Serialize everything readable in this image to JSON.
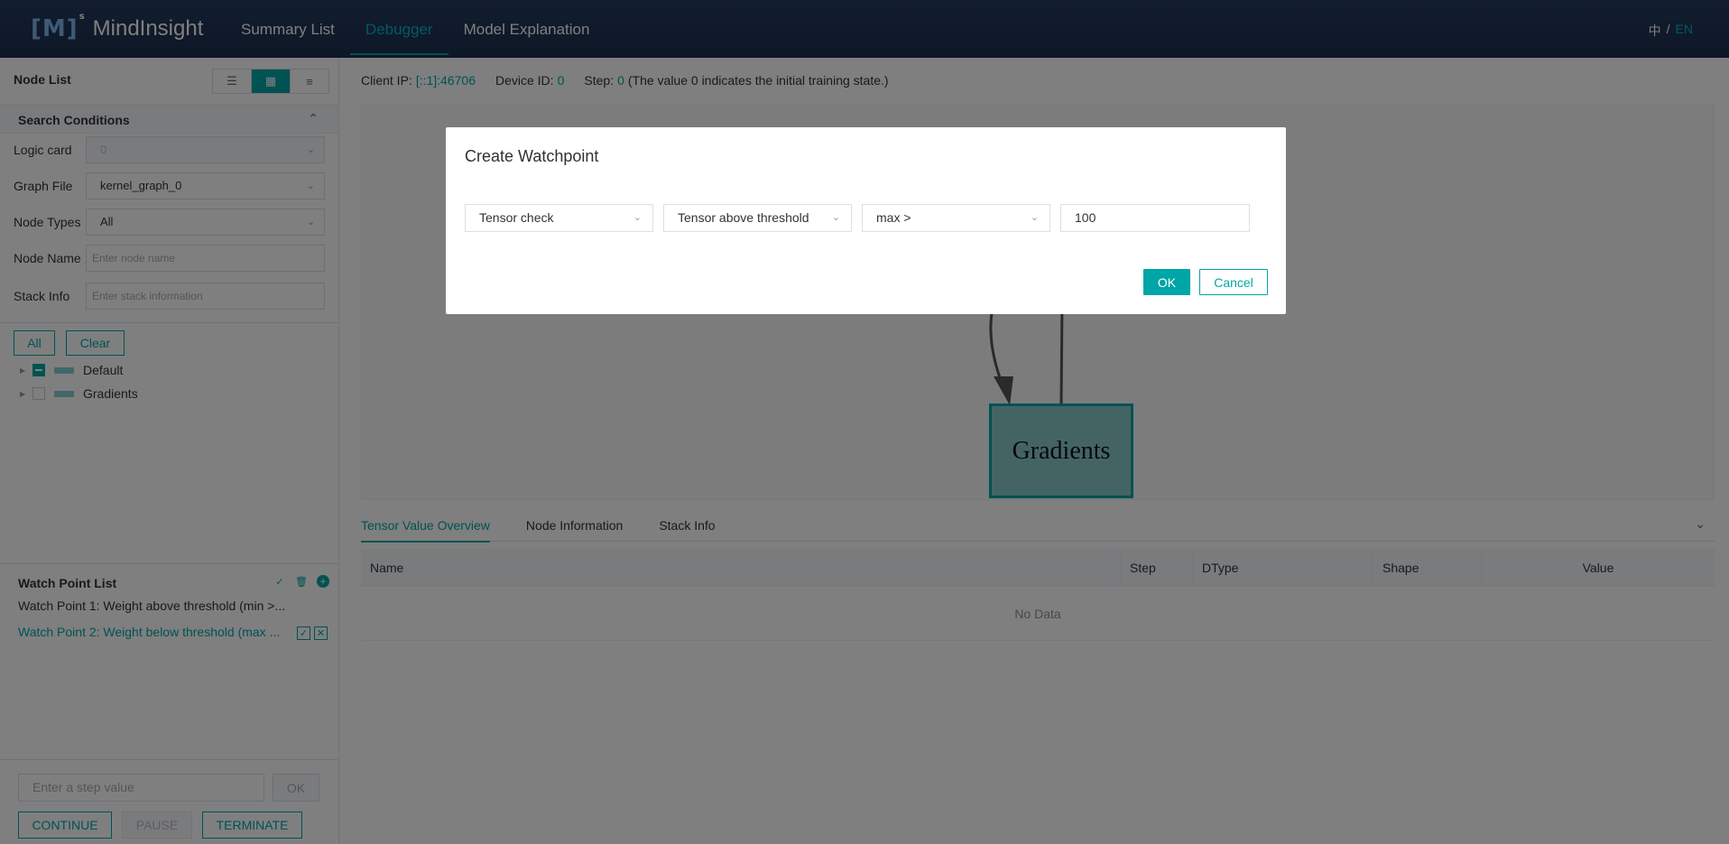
{
  "header": {
    "logo_mark": "[M]",
    "logo_sup": "s",
    "app_name": "MindInsight",
    "nav": [
      "Summary List",
      "Debugger",
      "Model Explanation"
    ],
    "lang_zh": "中",
    "lang_sep": "/",
    "lang_en": "EN"
  },
  "sidebar": {
    "node_list_title": "Node List",
    "search_conditions_title": "Search Conditions",
    "logic_card_label": "Logic card",
    "logic_card_value": "0",
    "graph_file_label": "Graph File",
    "graph_file_value": "kernel_graph_0",
    "node_types_label": "Node Types",
    "node_types_value": "All",
    "node_name_label": "Node Name",
    "node_name_placeholder": "Enter node name",
    "stack_info_label": "Stack Info",
    "stack_info_placeholder": "Enter stack information",
    "all_button": "All",
    "clear_button": "Clear",
    "tree": [
      "Default",
      "Gradients"
    ],
    "watch_point_list_title": "Watch Point List",
    "watch_points": [
      "Watch Point 1: Weight above threshold (min >...",
      "Watch Point 2: Weight below threshold (max ..."
    ],
    "step_placeholder": "Enter a step value",
    "step_ok": "OK",
    "continue": "CONTINUE",
    "pause": "PAUSE",
    "terminate": "TERMINATE"
  },
  "main": {
    "client_ip_label": "Client IP:",
    "client_ip_value": "[::1]:46706",
    "device_id_label": "Device ID:",
    "device_id_value": "0",
    "step_label": "Step:",
    "step_value": "0",
    "step_note": "(The value 0 indicates the initial training state.)",
    "graph_node_label": "Gradients",
    "tabs": [
      "Tensor Value Overview",
      "Node Information",
      "Stack Info"
    ],
    "table_headers": [
      "Name",
      "Step",
      "DType",
      "Shape",
      "Value"
    ],
    "table_empty": "No Data"
  },
  "modal": {
    "title": "Create Watchpoint",
    "select_category": "Tensor check",
    "select_condition": "Tensor above threshold",
    "select_param": "max >",
    "value_input": "100",
    "ok": "OK",
    "cancel": "Cancel"
  },
  "colors": {
    "accent": "#00a5a7",
    "header_bg": "#1b2e4c"
  }
}
